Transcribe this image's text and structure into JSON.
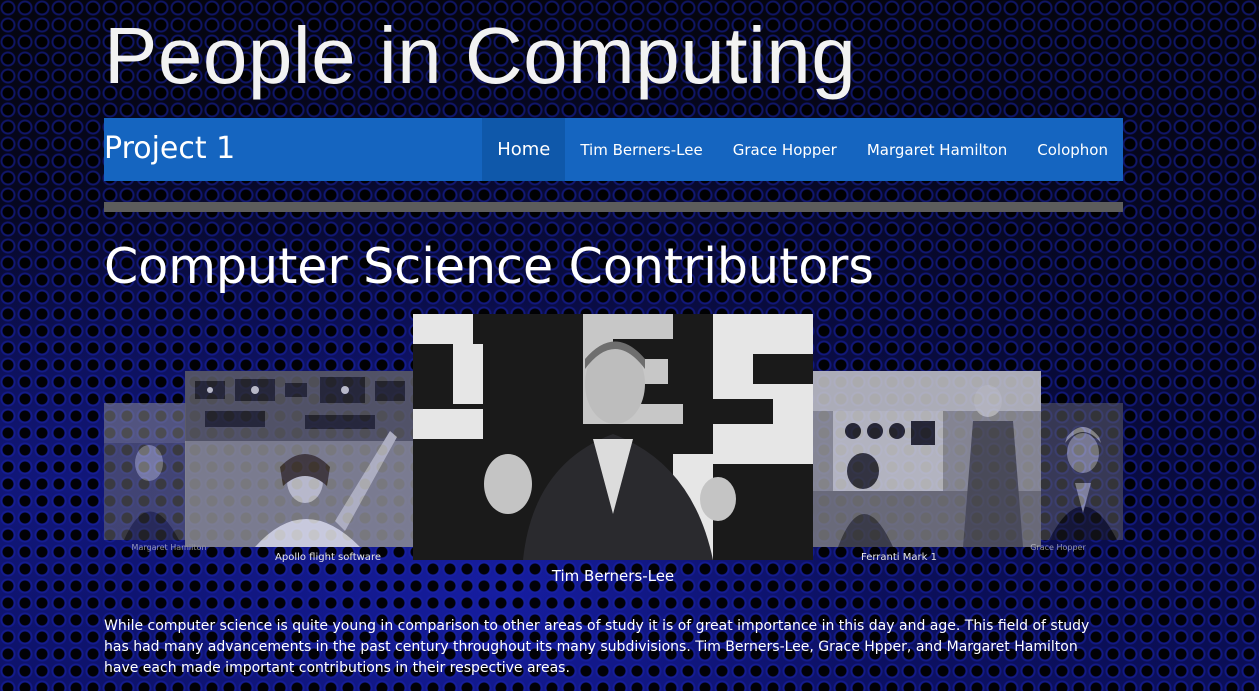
{
  "site": {
    "title": "People in Computing"
  },
  "navbar": {
    "brand": "Project 1",
    "items": [
      {
        "label": "Home",
        "active": true
      },
      {
        "label": "Tim Berners-Lee",
        "active": false
      },
      {
        "label": "Grace Hopper",
        "active": false
      },
      {
        "label": "Margaret Hamilton",
        "active": false
      },
      {
        "label": "Colophon",
        "active": false
      }
    ]
  },
  "main": {
    "heading": "Computer Science Contributors",
    "carousel": {
      "slides": [
        {
          "caption": "Margaret Hamilton",
          "image": "margaret-hamilton-photo"
        },
        {
          "caption": "Apollo flight software",
          "image": "apollo-flight-software-photo"
        },
        {
          "caption": "Tim Berners-Lee",
          "image": "tim-berners-lee-photo",
          "active": true
        },
        {
          "caption": "Ferranti Mark 1",
          "image": "ferranti-mark-1-photo"
        },
        {
          "caption": "Grace Hopper",
          "image": "grace-hopper-photo"
        }
      ]
    },
    "paragraph": "While computer science is quite young in comparison to other areas of study it is of great importance in this day and age. This field of study has had many advancements in the past century throughout its many subdivisions. Tim Berners-Lee, Grace Hpper, and Margaret Hamilton have each made important contributions in their respective areas."
  },
  "colors": {
    "navbar": "#1565c0",
    "navbar_active": "#0f58aa",
    "divider": "#5c5c5c",
    "background": "#02020a"
  }
}
